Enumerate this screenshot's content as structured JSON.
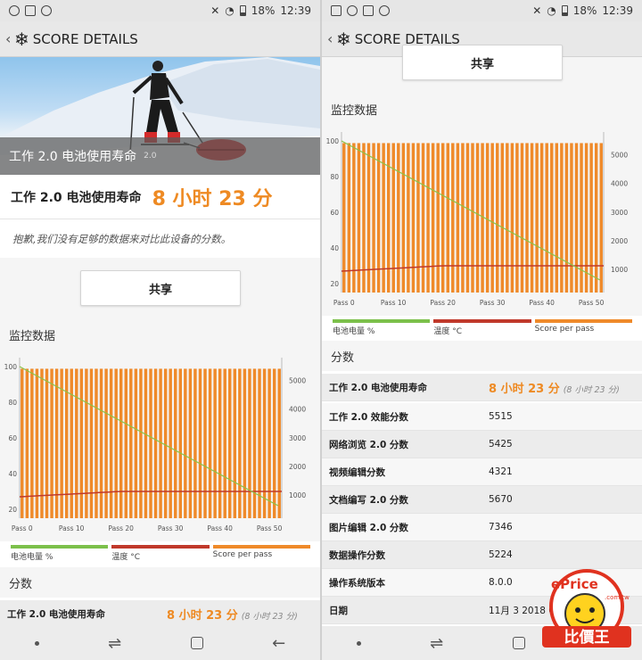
{
  "status": {
    "battery_pct": "18%",
    "time": "12:39"
  },
  "appbar": {
    "title": "SCORE DETAILS"
  },
  "hero": {
    "caption": "工作 2.0 电池使用寿命",
    "version": "2.0"
  },
  "result": {
    "label": "工作 2.0 电池使用寿命",
    "value": "8 小时 23 分"
  },
  "note": "抱歉,我们没有足够的数据来对比此设备的分数。",
  "share_label": "共享",
  "monitor_title": "监控数据",
  "scores_title": "分数",
  "chart_data": {
    "type": "bar",
    "x_ticks": [
      "Pass 0",
      "Pass 10",
      "Pass 20",
      "Pass 30",
      "Pass 40",
      "Pass 50"
    ],
    "bar_count": 53,
    "y_left_ticks": [
      100,
      80,
      60,
      40,
      20
    ],
    "y_right_ticks": [
      5000,
      4000,
      3000,
      2000,
      1000
    ],
    "ylim_left": [
      15,
      102
    ],
    "ylim_right": [
      200,
      5600
    ],
    "series": [
      {
        "name": "电池电量 %",
        "color": "#8bc34a",
        "axis": "left",
        "start": 100,
        "end": 22
      },
      {
        "name": "温度 °C",
        "color": "#c0392b",
        "axis": "left",
        "values_note": "",
        "start": 27,
        "end": 30
      },
      {
        "name": "Score per pass",
        "color": "#ef8a2a",
        "axis": "right",
        "value": 5400
      }
    ]
  },
  "legend": [
    {
      "label": "电池电量 %",
      "color": "#7cc04b"
    },
    {
      "label": "温度 °C",
      "color": "#c0392b"
    },
    {
      "label": "Score per pass",
      "color": "#ef8a2a"
    }
  ],
  "scores": [
    {
      "label": "工作 2.0 电池使用寿命",
      "value": "8 小时 23 分",
      "sub": "(8 小时 23 分)"
    },
    {
      "label": "工作 2.0 效能分数",
      "value": "5515"
    },
    {
      "label": "网络浏览 2.0 分数",
      "value": "5425"
    },
    {
      "label": "视频编辑分数",
      "value": "4321"
    },
    {
      "label": "文档编写 2.0 分数",
      "value": "5670"
    },
    {
      "label": "图片编辑 2.0 分数",
      "value": "7346"
    },
    {
      "label": "数据操作分数",
      "value": "5224"
    },
    {
      "label": "操作系统版本",
      "value": "8.0.0"
    },
    {
      "label": "日期",
      "value": "11月 3 2018 08:1"
    }
  ],
  "watermark": {
    "text1": "ePrice",
    "text2": ".com.tw",
    "text3": "比價王"
  }
}
